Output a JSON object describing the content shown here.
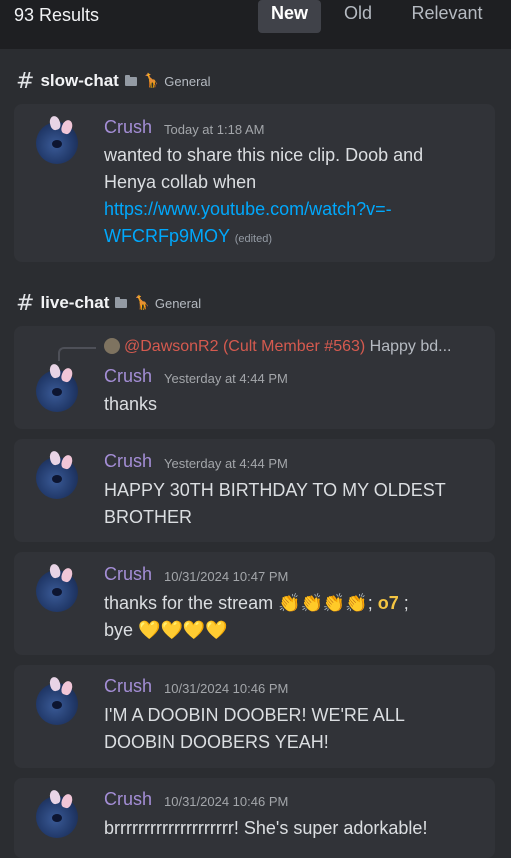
{
  "header": {
    "results": "93 Results",
    "tabs": [
      {
        "label": "New",
        "active": true
      },
      {
        "label": "Old",
        "active": false
      },
      {
        "label": "Relevant",
        "active": false
      }
    ]
  },
  "channels": [
    {
      "name": "slow-chat",
      "category_icon": "giraffe-icon",
      "category": "General"
    },
    {
      "name": "live-chat",
      "category_icon": "giraffe-icon",
      "category": "General"
    }
  ],
  "messages": [
    {
      "user": "Crush",
      "time": "Today at 1:18 AM",
      "text": "wanted to share this nice clip. Doob and Henya collab when",
      "link": "https://www.youtube.com/watch?v=-WFCRFp9MOY",
      "edited": "(edited)"
    },
    {
      "reply_to": "@DawsonR2 (Cult Member #563)",
      "reply_text": "Happy bd...",
      "user": "Crush",
      "time": "Yesterday at 4:44 PM",
      "text": "thanks"
    },
    {
      "user": "Crush",
      "time": "Yesterday at 4:44 PM",
      "text": "HAPPY 30TH BIRTHDAY TO MY OLDEST BROTHER"
    },
    {
      "user": "Crush",
      "time": "10/31/2024 10:47 PM",
      "text_a": "thanks for the stream",
      "claps": "👏👏👏👏",
      "salute": "o7",
      "text_b": "bye",
      "hearts": "💛💛💛💛"
    },
    {
      "user": "Crush",
      "time": "10/31/2024 10:46 PM",
      "text": "I'M A DOOBIN DOOBER! WE'RE ALL DOOBIN DOOBERS YEAH!"
    },
    {
      "user": "Crush",
      "time": "10/31/2024 10:46 PM",
      "text": "brrrrrrrrrrrrrrrrrrrr! She's super adorkable!"
    }
  ]
}
